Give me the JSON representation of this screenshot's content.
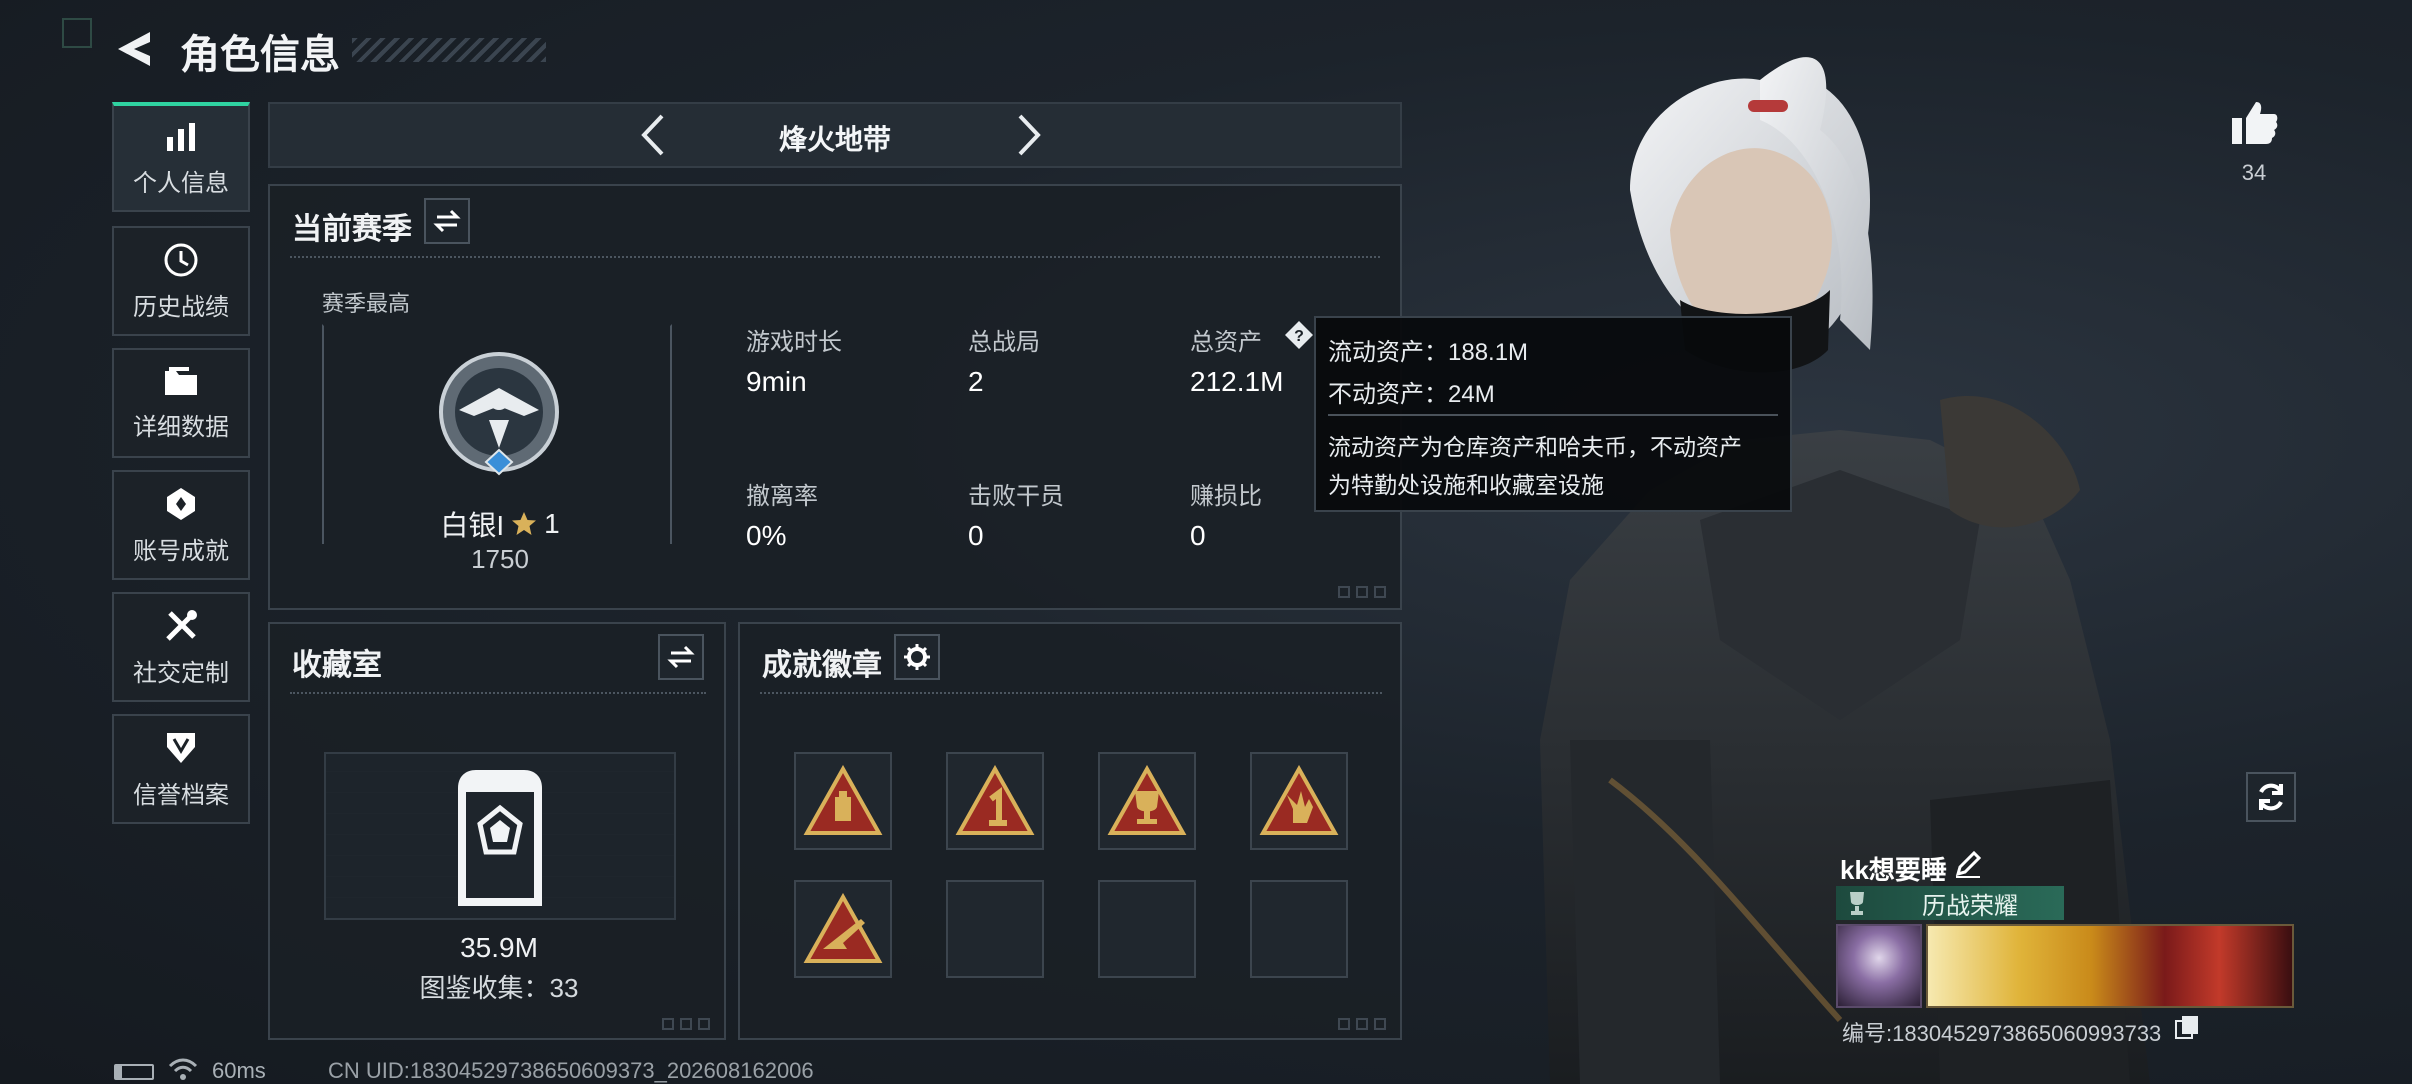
{
  "header": {
    "title": "角色信息"
  },
  "sidebar": {
    "items": [
      {
        "label": "个人信息",
        "icon": "bar-chart-icon",
        "active": true
      },
      {
        "label": "历史战绩",
        "icon": "clock-icon"
      },
      {
        "label": "详细数据",
        "icon": "folder-icon"
      },
      {
        "label": "账号成就",
        "icon": "achievement-icon"
      },
      {
        "label": "社交定制",
        "icon": "tools-icon"
      },
      {
        "label": "信誉档案",
        "icon": "shield-icon"
      }
    ]
  },
  "mode_selector": {
    "label": "烽火地带"
  },
  "season": {
    "title": "当前赛季",
    "best_label": "赛季最高",
    "rank_name": "白银I",
    "rank_stars": "1",
    "rank_score": "1750",
    "stats": [
      {
        "label": "游戏时长",
        "value": "9min"
      },
      {
        "label": "总战局",
        "value": "2"
      },
      {
        "label": "总资产",
        "value": "212.1M"
      },
      {
        "label": "撤离率",
        "value": "0%"
      },
      {
        "label": "击败干员",
        "value": "0"
      },
      {
        "label": "赚损比",
        "value": "0"
      }
    ]
  },
  "tooltip": {
    "liquid": "流动资产：188.1M",
    "fixed": "不动资产：24M",
    "desc_line1": "流动资产为仓库资产和哈夫币，不动资产",
    "desc_line2": "为特勤处设施和收藏室设施"
  },
  "collection": {
    "title": "收藏室",
    "value": "35.9M",
    "catalog": "图鉴收集：33"
  },
  "achievements": {
    "title": "成就徽章",
    "badges": [
      "mine-badge",
      "first-place-badge",
      "trophy-badge",
      "hand-badge",
      "rifle-badge",
      "",
      "",
      ""
    ]
  },
  "likes": {
    "count": "34"
  },
  "profile": {
    "name": "kk想要睡",
    "honor": "历战荣耀",
    "id_text": "编号:1830452973865060993733"
  },
  "status_bar": {
    "ping": "60ms",
    "uid": "CN UID:18304529738650609373_202608162006"
  },
  "colors": {
    "accent": "#2fd3a1",
    "honor_bg": "#1f5a4a",
    "gold": "#d9b15a"
  }
}
